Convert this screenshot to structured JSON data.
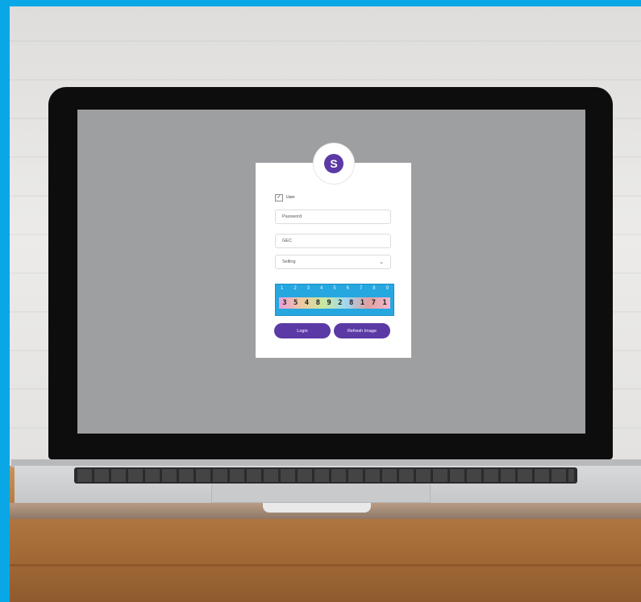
{
  "login_form": {
    "logo_glyph": "S",
    "user_label": "User",
    "password_placeholder": "Password",
    "second_field_value": "GEC",
    "select_value": "Selling",
    "captcha_numbers": [
      "1",
      "2",
      "3",
      "4",
      "5",
      "6",
      "7",
      "8",
      "9"
    ],
    "captcha_code": [
      "3",
      "5",
      "4",
      "8",
      "9",
      "2",
      "8",
      "1",
      "7",
      "1"
    ],
    "login_label": "Login",
    "refresh_label": "Refresh Image"
  },
  "colors": {
    "accent": "#5b3aa6",
    "captcha_bg": "#26a7e0",
    "frame_blue": "#0aa7e6"
  }
}
